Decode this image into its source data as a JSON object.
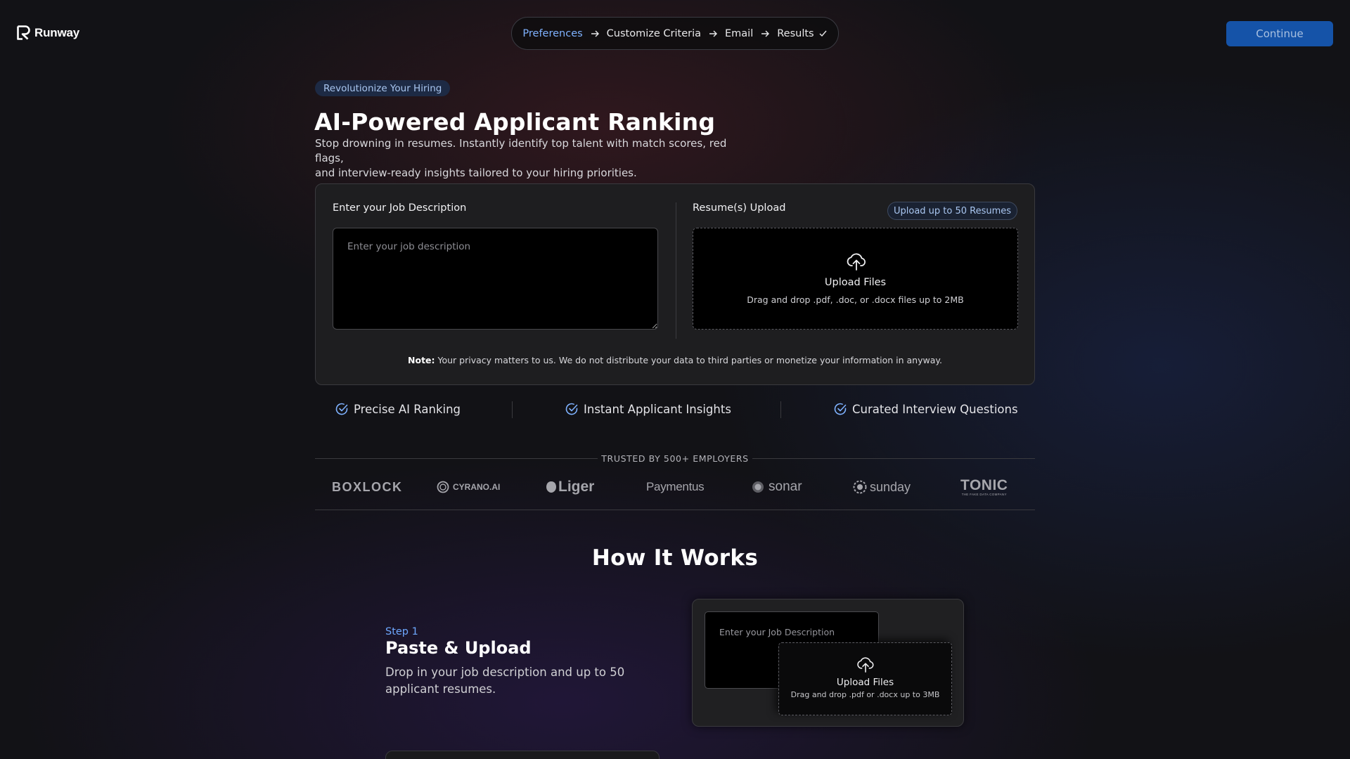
{
  "app": {
    "name": "Runway"
  },
  "stepper": {
    "steps": [
      {
        "label": "Preferences",
        "active": true
      },
      {
        "label": "Customize Criteria",
        "active": false
      },
      {
        "label": "Email",
        "active": false
      },
      {
        "label": "Results",
        "active": false
      }
    ]
  },
  "header": {
    "continue_label": "Continue"
  },
  "hero": {
    "badge": "Revolutionize Your Hiring",
    "title": "AI-Powered Applicant Ranking",
    "subtitle_line1": "Stop drowning in resumes. Instantly identify top talent with match scores, red flags,",
    "subtitle_line2": "and interview-ready insights tailored to your hiring priorities."
  },
  "form": {
    "job_description_label": "Enter your Job Description",
    "job_description_placeholder": "Enter your job description",
    "job_description_value": "",
    "resume_label": "Resume(s) Upload",
    "resume_badge": "Upload up to 50 Resumes",
    "upload_title": "Upload Files",
    "upload_hint": "Drag and drop .pdf, .doc, or .docx files up to 2MB",
    "note_label": "Note:",
    "note_text": "Your privacy matters to us. We do not distribute your data to third parties or monetize your information in anyway."
  },
  "features": [
    {
      "label": "Precise AI Ranking",
      "icon": "check-circle-icon"
    },
    {
      "label": "Instant Applicant Insights",
      "icon": "check-circle-icon"
    },
    {
      "label": "Curated Interview Questions",
      "icon": "check-circle-icon"
    }
  ],
  "trusted": {
    "label": "TRUSTED BY 500+ EMPLOYERS",
    "employers": [
      {
        "name": "BOXLOCK"
      },
      {
        "name": "CYRANO.AI"
      },
      {
        "name": "Liger"
      },
      {
        "name": "Paymentus"
      },
      {
        "name": "sonar"
      },
      {
        "name": "sunday"
      },
      {
        "name": "TONIC",
        "tagline": "THE FAKE DATA COMPANY"
      }
    ]
  },
  "how_it_works": {
    "title": "How It Works",
    "steps": [
      {
        "number": "Step 1",
        "title": "Paste & Upload",
        "description": "Drop in your job description and up to 50 applicant resumes.",
        "preview": {
          "jd_label": "Enter your Job Description",
          "upload_title": "Upload Files",
          "upload_hint": "Drag and drop .pdf or .docx up to 3MB"
        }
      }
    ]
  },
  "colors": {
    "accent": "#7fb2ff",
    "primary_button": "#1553a8",
    "background": "#121216",
    "card": "#1e1e20"
  }
}
